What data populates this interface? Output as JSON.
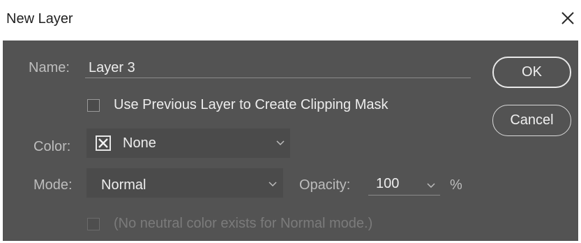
{
  "dialog": {
    "title": "New Layer"
  },
  "form": {
    "name_label": "Name:",
    "name_value": "Layer 3",
    "clipping_mask_label": "Use Previous Layer to Create Clipping Mask",
    "clipping_mask_checked": false,
    "color_label": "Color:",
    "color_value": "None",
    "color_icon": "x-box-icon",
    "mode_label": "Mode:",
    "mode_value": "Normal",
    "opacity_label": "Opacity:",
    "opacity_value": "100",
    "opacity_unit": "%",
    "neutral_note": "(No neutral color exists for Normal mode.)",
    "neutral_checked": false,
    "neutral_enabled": false
  },
  "buttons": {
    "ok_label": "OK",
    "cancel_label": "Cancel"
  },
  "colors": {
    "panel_bg": "#535353",
    "field_bg": "#4b4b4b",
    "text": "#ededed",
    "label": "#bdbdbd",
    "disabled": "#7b7b7b"
  }
}
